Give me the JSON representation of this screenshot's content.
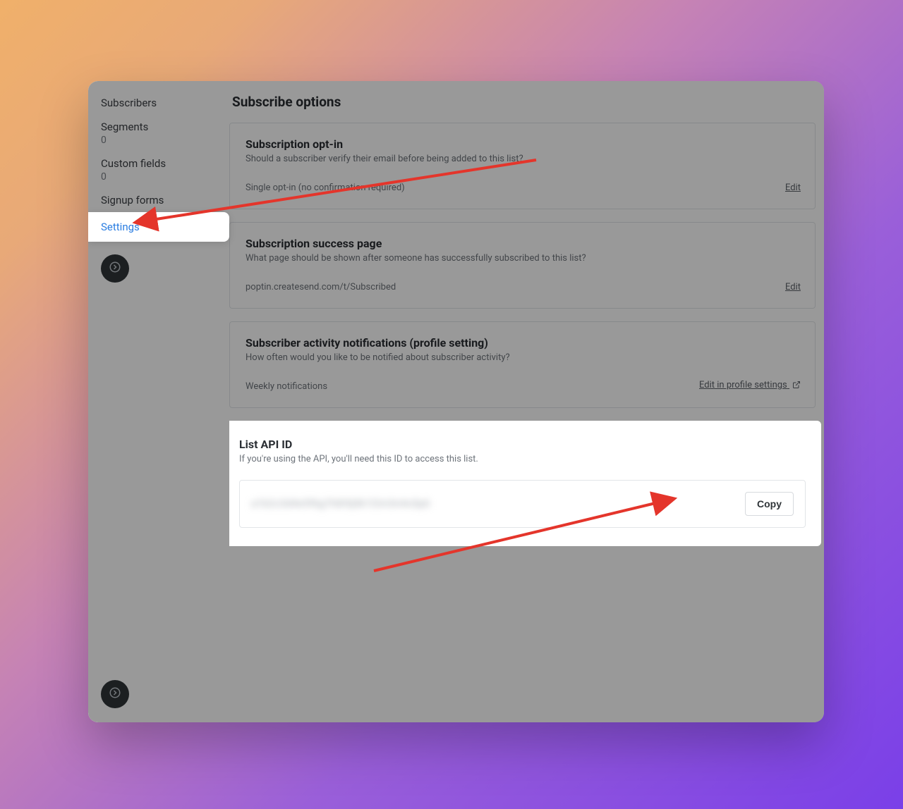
{
  "sidebar": {
    "items": [
      {
        "label": "Subscribers"
      },
      {
        "label": "Segments",
        "count": "0"
      },
      {
        "label": "Custom fields",
        "count": "0"
      },
      {
        "label": "Signup forms"
      },
      {
        "label": "Settings",
        "active": true
      }
    ]
  },
  "main": {
    "title": "Subscribe options",
    "cards": {
      "optin": {
        "title": "Subscription opt-in",
        "desc": "Should a subscriber verify their email before being added to this list?",
        "value": "Single opt-in (no confirmation required)",
        "edit": "Edit"
      },
      "success": {
        "title": "Subscription success page",
        "desc": "What page should be shown after someone has successfully subscribed to this list?",
        "value": "poptin.createsend.com/t/Subscribed",
        "edit": "Edit"
      },
      "activity": {
        "title": "Subscriber activity notifications (profile setting)",
        "desc": "How often would you like to be notified about subscriber activity?",
        "value": "Weekly notifications",
        "edit": "Edit in profile settings"
      },
      "api": {
        "title": "List API ID",
        "desc": "If you're using the API, you'll need this ID to access this list.",
        "masked": "a1b2c3d4e5f6g7h8i9j0k1l2m3n4o5p6",
        "copy": "Copy"
      }
    }
  }
}
